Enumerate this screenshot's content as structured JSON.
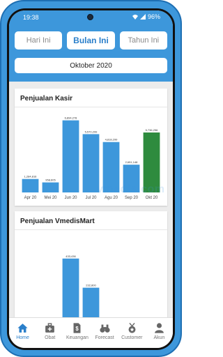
{
  "status": {
    "time": "19:38",
    "battery": "96%"
  },
  "tabs": [
    {
      "label": "Hari Ini",
      "active": false
    },
    {
      "label": "Bulan Ini",
      "active": true
    },
    {
      "label": "Tahun Ini",
      "active": false
    }
  ],
  "period": "Oktober 2020",
  "watermark": "vmedis.com",
  "charts": {
    "kasir_title": "Penjualan Kasir",
    "mart_title": "Penjualan VmedisMart"
  },
  "chart_data": [
    {
      "type": "bar",
      "title": "Penjualan Kasir",
      "categories": [
        "Apr 20",
        "Mei 20",
        "Jun 20",
        "Jul 20",
        "Agu 20",
        "Sep 20",
        "Okt 20"
      ],
      "values": [
        1284816,
        958605,
        6894278,
        5570299,
        4818299,
        2651148,
        5736256
      ],
      "value_labels": [
        "1,284,816",
        "958,605",
        "6,894,278",
        "5,570,299",
        "4,818,299",
        "2,651,148",
        "5,736,256"
      ],
      "ylim": [
        0,
        7000000
      ],
      "colors": [
        "#3d97db",
        "#3d97db",
        "#3d97db",
        "#3d97db",
        "#3d97db",
        "#3d97db",
        "#2e8b3e"
      ]
    },
    {
      "type": "bar",
      "title": "Penjualan VmedisMart",
      "categories": [
        "",
        "",
        "",
        "",
        "",
        "",
        ""
      ],
      "values": [
        0,
        0,
        433436,
        232800,
        0,
        0,
        0
      ],
      "value_labels": [
        "",
        "",
        "433,436",
        "232,800",
        "",
        "",
        ""
      ],
      "ylim": [
        0,
        500000
      ],
      "colors": [
        "#3d97db",
        "#3d97db",
        "#3d97db",
        "#3d97db",
        "#3d97db",
        "#3d97db",
        "#3d97db"
      ]
    }
  ],
  "nav": [
    {
      "label": "Home",
      "icon": "home-icon",
      "active": true
    },
    {
      "label": "Obat",
      "icon": "medkit-icon",
      "active": false
    },
    {
      "label": "Keuangan",
      "icon": "money-icon",
      "active": false
    },
    {
      "label": "Forecast",
      "icon": "binoculars-icon",
      "active": false
    },
    {
      "label": "Customer",
      "icon": "badge-icon",
      "active": false
    },
    {
      "label": "Akun",
      "icon": "user-icon",
      "active": false
    }
  ]
}
